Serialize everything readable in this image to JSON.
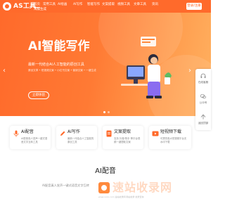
{
  "nav": {
    "logo": "AS工具",
    "items": [
      "首页",
      "常用工具",
      "AI绘画",
      "AI写作",
      "智能写作",
      "文案提取",
      "视频工具",
      "文章工具",
      "资讯"
    ],
    "second_row": "海报生成",
    "login": "登录/注册"
  },
  "hero": {
    "title": "AI智能写作",
    "subtitle": "最新一代结合AI人工智能的原创工具",
    "desc": "原创文章 • 短视频文案 • 小红书文案 • 营销文案 • 一键生成",
    "button": "立即体验"
  },
  "side_toolbar": [
    {
      "label": "在线客服",
      "icon": "headset-icon"
    },
    {
      "label": "公众号",
      "icon": "wechat-icon"
    },
    {
      "label": "返回顶部",
      "icon": "arrow-up-icon"
    }
  ],
  "features": [
    {
      "title": "AI配音",
      "desc": "AI配音真人发声一键式语音文字互转工具",
      "icon": "microphone-icon",
      "color": "#ff6a2b"
    },
    {
      "title": "AI写作",
      "desc": "最新一代结合人工智能的原创工具",
      "icon": "pen-icon",
      "color": "#ff6a2b"
    },
    {
      "title": "文案提取",
      "desc": "支持 抖音/快手 等平台视频一键提取文案",
      "icon": "document-icon",
      "color": "#ff6a2b"
    },
    {
      "title": "短视频下载",
      "desc": "可提供各大短视频平台无水印下载",
      "icon": "download-icon",
      "color": "#ff6a2b"
    }
  ],
  "section": {
    "title": "AI配音",
    "desc": "AI配音真人发声一键式语音文字互转"
  },
  "watermark": {
    "text": "速站收录网",
    "sub": "www.xxxx.com 速站收录网 网站收录 收录查询"
  },
  "colors": {
    "brand": "#ff6a2b"
  }
}
